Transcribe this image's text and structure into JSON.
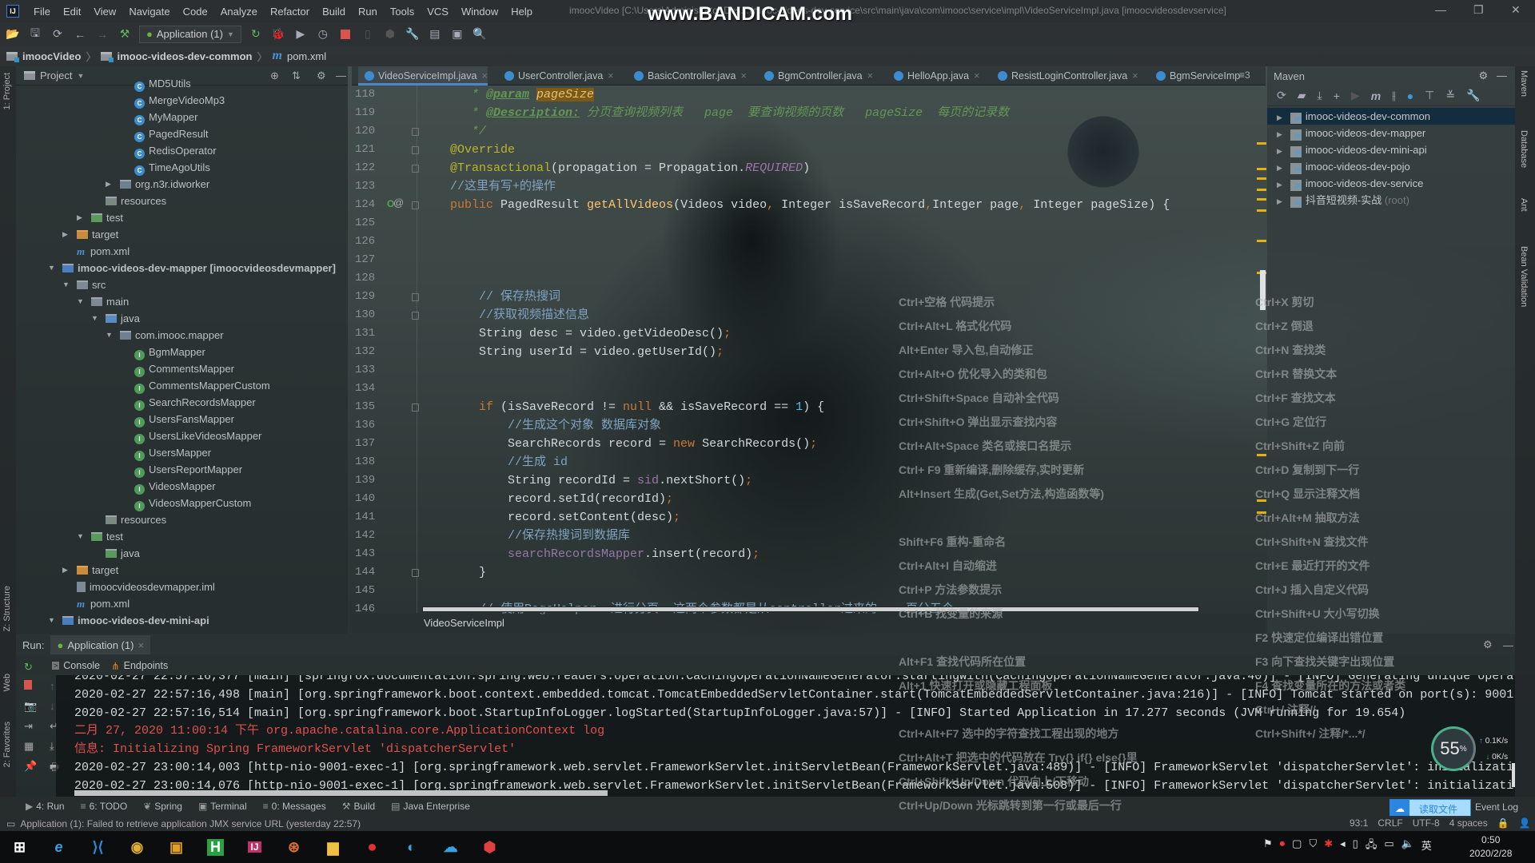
{
  "window": {
    "title": "imoocVideo [C:\\Users\\Administrator\\Des...\\imooc-videos-dev-service\\src\\main\\java\\com\\imooc\\service\\impl\\VideoServiceImpl.java [imoocvideosdevservice]",
    "watermark": "www.BANDICAM.com",
    "logo": "IJ"
  },
  "menu": [
    "File",
    "Edit",
    "View",
    "Navigate",
    "Code",
    "Analyze",
    "Refactor",
    "Build",
    "Run",
    "Tools",
    "VCS",
    "Window",
    "Help"
  ],
  "toolbar": {
    "run_config": "Application (1)"
  },
  "breadcrumb": [
    "imoocVideo",
    "imooc-videos-dev-common",
    "pom.xml"
  ],
  "project": {
    "title": "Project",
    "rows": [
      {
        "label": "MD5Utils",
        "level": 6,
        "icon": "class"
      },
      {
        "label": "MergeVideoMp3",
        "level": 6,
        "icon": "class"
      },
      {
        "label": "MyMapper",
        "level": 6,
        "icon": "class"
      },
      {
        "label": "PagedResult",
        "level": 6,
        "icon": "class"
      },
      {
        "label": "RedisOperator",
        "level": 6,
        "icon": "class"
      },
      {
        "label": "TimeAgoUtils",
        "level": 6,
        "icon": "class"
      },
      {
        "label": "org.n3r.idworker",
        "level": 5,
        "icon": "pkg",
        "arrow": "right"
      },
      {
        "label": "resources",
        "level": 4,
        "icon": "res"
      },
      {
        "label": "test",
        "level": 3,
        "icon": "test",
        "arrow": "right"
      },
      {
        "label": "target",
        "level": 2,
        "icon": "target",
        "arrow": "right"
      },
      {
        "label": "pom.xml",
        "level": 2,
        "icon": "maven"
      },
      {
        "label": "imooc-videos-dev-mapper",
        "suffix": "[imoocvideosdevmapper]",
        "level": 1,
        "icon": "module",
        "arrow": "down"
      },
      {
        "label": "src",
        "level": 2,
        "icon": "folder",
        "arrow": "down"
      },
      {
        "label": "main",
        "level": 3,
        "icon": "folder",
        "arrow": "down"
      },
      {
        "label": "java",
        "level": 4,
        "icon": "src",
        "arrow": "down"
      },
      {
        "label": "com.imooc.mapper",
        "level": 5,
        "icon": "pkg",
        "arrow": "down"
      },
      {
        "label": "BgmMapper",
        "level": 6,
        "icon": "iface"
      },
      {
        "label": "CommentsMapper",
        "level": 6,
        "icon": "iface"
      },
      {
        "label": "CommentsMapperCustom",
        "level": 6,
        "icon": "iface"
      },
      {
        "label": "SearchRecordsMapper",
        "level": 6,
        "icon": "iface"
      },
      {
        "label": "UsersFansMapper",
        "level": 6,
        "icon": "iface"
      },
      {
        "label": "UsersLikeVideosMapper",
        "level": 6,
        "icon": "iface"
      },
      {
        "label": "UsersMapper",
        "level": 6,
        "icon": "iface"
      },
      {
        "label": "UsersReportMapper",
        "level": 6,
        "icon": "iface"
      },
      {
        "label": "VideosMapper",
        "level": 6,
        "icon": "iface"
      },
      {
        "label": "VideosMapperCustom",
        "level": 6,
        "icon": "iface"
      },
      {
        "label": "resources",
        "level": 4,
        "icon": "res"
      },
      {
        "label": "test",
        "level": 3,
        "icon": "test",
        "arrow": "down"
      },
      {
        "label": "java",
        "level": 4,
        "icon": "test"
      },
      {
        "label": "target",
        "level": 2,
        "icon": "target",
        "arrow": "right"
      },
      {
        "label": "imoocvideosdevmapper.iml",
        "level": 2,
        "icon": "iml"
      },
      {
        "label": "pom.xml",
        "level": 2,
        "icon": "maven"
      },
      {
        "label": "imooc-videos-dev-mini-api",
        "level": 1,
        "icon": "module",
        "arrow": "down"
      }
    ]
  },
  "editor": {
    "tabs": [
      "VideoServiceImpl.java",
      "UserController.java",
      "BasicController.java",
      "BgmController.java",
      "HelloApp.java",
      "ResistLoginController.java",
      "BgmServiceImp"
    ],
    "active_tab": 0,
    "overflow": "≡3",
    "breadcrumb": "VideoServiceImpl",
    "lines": [
      {
        "n": 118,
        "t": [
          [
            "   * ",
            "doc"
          ],
          [
            "@param",
            "doctag"
          ],
          [
            " ",
            "doc"
          ],
          [
            "pageSize",
            "hl"
          ]
        ]
      },
      {
        "n": 119,
        "t": [
          [
            "   * ",
            "doc"
          ],
          [
            "@Description:",
            "doctag"
          ],
          [
            " 分页查询视频列表   page  要查询视频的页数   pageSize  每页的记录数",
            "doc"
          ]
        ]
      },
      {
        "n": 120,
        "t": [
          [
            "   */",
            "doc"
          ]
        ]
      },
      {
        "n": 121,
        "t": [
          [
            "@Override",
            "ann"
          ]
        ]
      },
      {
        "n": 122,
        "t": [
          [
            "@Transactional",
            "ann"
          ],
          [
            "(propagation = Propagation.",
            ""
          ],
          [
            "REQUIRED",
            "fldi"
          ],
          [
            ")",
            ""
          ]
        ]
      },
      {
        "n": 123,
        "t": [
          [
            "//这里有写+的操作",
            "cm"
          ]
        ]
      },
      {
        "n": 124,
        "t": [
          [
            "public ",
            "kw"
          ],
          [
            "PagedResult ",
            ""
          ],
          [
            "getAllVideos",
            "fn"
          ],
          [
            "(Videos video",
            ""
          ],
          [
            ", ",
            "punc"
          ],
          [
            "Integer isSaveRecord",
            ""
          ],
          [
            ",",
            "punc"
          ],
          [
            "Integer page",
            ""
          ],
          [
            ", ",
            "punc"
          ],
          [
            "Integer pageSize) {",
            ""
          ]
        ]
      },
      {
        "n": 125,
        "t": []
      },
      {
        "n": 126,
        "t": []
      },
      {
        "n": 127,
        "t": []
      },
      {
        "n": 128,
        "t": []
      },
      {
        "n": 129,
        "t": [
          [
            "    // 保存热搜词",
            "cm"
          ]
        ]
      },
      {
        "n": 130,
        "t": [
          [
            "    //获取视频描述信息",
            "cm"
          ]
        ]
      },
      {
        "n": 131,
        "t": [
          [
            "    String desc = video.getVideoDesc()",
            ""
          ],
          [
            ";",
            "punc"
          ]
        ]
      },
      {
        "n": 132,
        "t": [
          [
            "    String userId = video.getUserId()",
            ""
          ],
          [
            ";",
            "punc"
          ]
        ]
      },
      {
        "n": 133,
        "t": []
      },
      {
        "n": 134,
        "t": []
      },
      {
        "n": 135,
        "t": [
          [
            "    if ",
            "kw"
          ],
          [
            "(isSaveRecord != ",
            ""
          ],
          [
            "null ",
            "kw"
          ],
          [
            "&& isSaveRecord == ",
            ""
          ],
          [
            "1",
            "num"
          ],
          [
            ") {",
            ""
          ]
        ]
      },
      {
        "n": 136,
        "t": [
          [
            "        //生成这个对象 数据库对象",
            "cm"
          ]
        ]
      },
      {
        "n": 137,
        "t": [
          [
            "        SearchRecords record = ",
            ""
          ],
          [
            "new ",
            "kw"
          ],
          [
            "SearchRecords()",
            ""
          ],
          [
            ";",
            "punc"
          ]
        ]
      },
      {
        "n": 138,
        "t": [
          [
            "        //生成 id",
            "cm"
          ]
        ]
      },
      {
        "n": 139,
        "t": [
          [
            "        String recordId = ",
            ""
          ],
          [
            "sid",
            "fld"
          ],
          [
            ".nextShort()",
            ""
          ],
          [
            ";",
            "punc"
          ]
        ]
      },
      {
        "n": 140,
        "t": [
          [
            "        record.setId(recordId)",
            ""
          ],
          [
            ";",
            "punc"
          ]
        ]
      },
      {
        "n": 141,
        "t": [
          [
            "        record.setContent(desc)",
            ""
          ],
          [
            ";",
            "punc"
          ]
        ]
      },
      {
        "n": 142,
        "t": [
          [
            "        //保存热搜词到数据库",
            "cm"
          ]
        ]
      },
      {
        "n": 143,
        "t": [
          [
            "        ",
            ""
          ],
          [
            "searchRecordsMapper",
            "fld"
          ],
          [
            ".insert(record)",
            ""
          ],
          [
            ";",
            "punc"
          ]
        ]
      },
      {
        "n": 144,
        "t": [
          [
            "    }",
            ""
          ]
        ]
      },
      {
        "n": 145,
        "t": []
      },
      {
        "n": 146,
        "t": [
          [
            "    // 使用PageHelper  进行分页  这两个参数都是从controller过来的    页分五个",
            "cm"
          ]
        ]
      }
    ]
  },
  "maven": {
    "title": "Maven",
    "items": [
      {
        "label": "imooc-videos-dev-common",
        "selected": true
      },
      {
        "label": "imooc-videos-dev-mapper"
      },
      {
        "label": "imooc-videos-dev-mini-api"
      },
      {
        "label": "imooc-videos-dev-pojo"
      },
      {
        "label": "imooc-videos-dev-service"
      },
      {
        "label": "抖音短视频-实战",
        "suffix": "(root)"
      }
    ]
  },
  "right_strip": [
    "Maven",
    "Database",
    "Ant",
    "Bean Validation"
  ],
  "left_strip": [
    "1: Project",
    "Z: Structure",
    "Web",
    "2: Favorites"
  ],
  "run": {
    "label": "Run:",
    "tab": "Application (1)",
    "console_tab": "Console",
    "endpoints_tab": "Endpoints",
    "lines": [
      {
        "text": "2020-02-27 22:57:16,377 [main] [springfox.documentation.spring.web.readers.operation.CachingOperationNameGenerator.startingWith(CachingOperationNameGenerator.java:40)] - [INFO] Generating unique operat",
        "err": false
      },
      {
        "text": "2020-02-27 22:57:16,498 [main] [org.springframework.boot.context.embedded.tomcat.TomcatEmbeddedServletContainer.start(TomcatEmbeddedServletContainer.java:216)] - [INFO] Tomcat started on port(s): 9001",
        "err": false
      },
      {
        "text": "2020-02-27 22:57:16,514 [main] [org.springframework.boot.StartupInfoLogger.logStarted(StartupInfoLogger.java:57)] - [INFO] Started Application in 17.277 seconds (JVM running for 19.654)",
        "err": false
      },
      {
        "text": "二月 27, 2020 11:00:14 下午 org.apache.catalina.core.ApplicationContext log",
        "err": true
      },
      {
        "text": "信息: Initializing Spring FrameworkServlet 'dispatcherServlet'",
        "err": true
      },
      {
        "text": "2020-02-27 23:00:14,003 [http-nio-9001-exec-1] [org.springframework.web.servlet.FrameworkServlet.initServletBean(FrameworkServlet.java:489)] - [INFO] FrameworkServlet 'dispatcherServlet': initializati",
        "err": false
      },
      {
        "text": "2020-02-27 23:00:14,076 [http-nio-9001-exec-1] [org.springframework.web.servlet.FrameworkServlet.initServletBean(FrameworkServlet.java:508)] - [INFO] FrameworkServlet 'dispatcherServlet': initializati",
        "err": false
      }
    ]
  },
  "shortcuts": {
    "left": [
      "Ctrl+空格  代码提示",
      "Ctrl+Alt+L  格式化代码",
      "Alt+Enter 导入包,自动修正",
      "Ctrl+Alt+O  优化导入的类和包",
      "Ctrl+Shift+Space 自动补全代码",
      "Ctrl+Shift+O  弹出显示查找内容",
      "Ctrl+Alt+Space  类名或接口名提示",
      " Ctrl+ F9 重新编译,删除缓存,实时更新",
      "Alt+Insert  生成(Get,Set方法,构造函数等)",
      "",
      "Shift+F6  重构-重命名",
      "Ctrl+Alt+I  自动缩进",
      "Ctrl+P  方法参数提示",
      "Ctrl+B  找变量的来源",
      "",
      "Alt+F1 查找代码所在位置",
      "Alt+1 快速打开或隐藏工程面板",
      "",
      "Ctrl+Alt+F7  选中的字符查找工程出现的地方",
      "Ctrl+Alt+T  把选中的代码放在 Try{} if{} else{}里",
      "Ctrl+Shift+Up/Down 代码向上/下移动",
      "Ctrl+Up/Down  光标跳转到第一行或最后一行"
    ],
    "right": [
      "Ctrl+X   剪切",
      "Ctrl+Z   倒退",
      "Ctrl+N    查找类",
      "Ctrl+R 替换文本",
      "Ctrl+F 查找文本",
      "Ctrl+G   定位行",
      "Ctrl+Shift+Z  向前",
      "Ctrl+D  复制到下一行",
      "Ctrl+Q   显示注释文档",
      "Ctrl+Alt+M  抽取方法",
      "Ctrl+Shift+N 查找文件",
      "Ctrl+E 最近打开的文件",
      "Ctrl+J   插入自定义代码",
      "Ctrl+Shift+U 大小写切换",
      "F2  快速定位编译出错位置",
      "F3   向下查找关键字出现位置",
      "F4   查找变量所在的方法或者类",
      "Ctrl+/  注释//",
      "Ctrl+Shift+/  注释/*...*/"
    ]
  },
  "bottom_tools": [
    "4: Run",
    "6: TODO",
    "Spring",
    "Terminal",
    "0: Messages",
    "Build",
    "Java Enterprise"
  ],
  "event_log": "Event Log",
  "baidu_button": "读取文件",
  "status": {
    "message": "Application (1): Failed to retrieve application JMX service URL (yesterday 22:57)",
    "position": "93:1",
    "line_sep": "CRLF",
    "encoding": "UTF-8",
    "indent": "4 spaces"
  },
  "widget": {
    "percent": "55",
    "percent_sign": "%",
    "up": "0.1K/s",
    "down": "0K/s"
  },
  "clock": {
    "time": "0:50",
    "date": "2020/2/28"
  },
  "colors": {
    "accent": "#4a88c7",
    "keyword": "#cc7832",
    "error": "#e0504e",
    "marker": "#e4b10f"
  }
}
